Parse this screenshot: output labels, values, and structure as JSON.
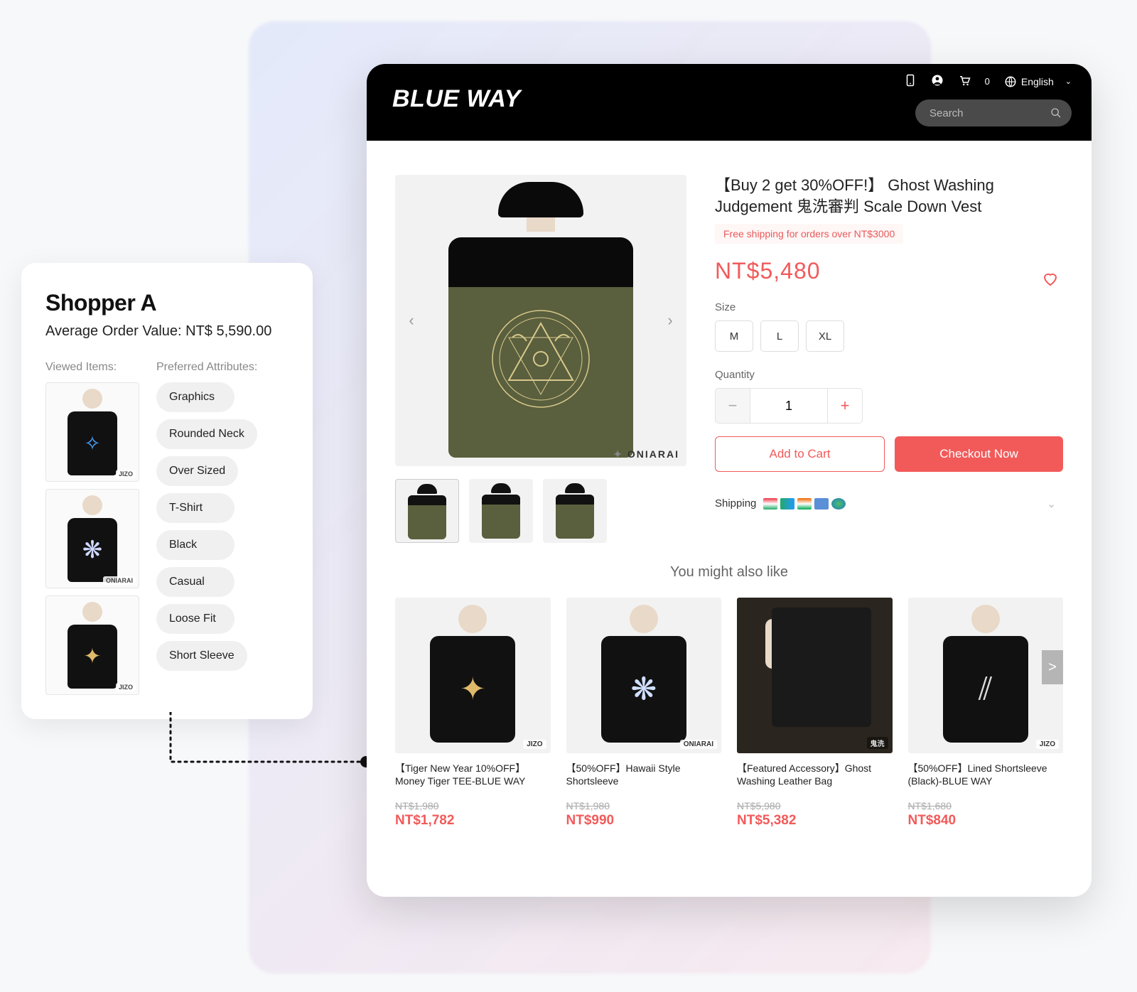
{
  "shopper_card": {
    "title": "Shopper A",
    "aov_label": "Average Order Value: NT$ 5,590.00",
    "viewed_head": "Viewed Items:",
    "pref_head": "Preferred Attributes:",
    "viewed_brands": [
      "JIZO",
      "ONIARAI",
      "JIZO"
    ],
    "attributes": [
      "Graphics",
      "Rounded Neck",
      "Over Sized",
      "T-Shirt",
      "Black",
      "Casual",
      "Loose Fit",
      "Short Sleeve"
    ]
  },
  "header": {
    "logo": "BLUE WAY",
    "cart_count": "0",
    "language": "English",
    "search_placeholder": "Search"
  },
  "product": {
    "title": "【Buy 2 get 30%OFF!】 Ghost Washing Judgement 鬼洗審判 Scale Down Vest",
    "shipping_badge": "Free shipping for orders over NT$3000",
    "price": "NT$5,480",
    "size_label": "Size",
    "sizes": [
      "M",
      "L",
      "XL"
    ],
    "qty_label": "Quantity",
    "qty_value": "1",
    "add_to_cart": "Add to Cart",
    "checkout_now": "Checkout Now",
    "shipping_label": "Shipping",
    "gallery_brand": "ONIARAI"
  },
  "recs": {
    "title": "You might also like",
    "items": [
      {
        "name": "【Tiger New Year 10%OFF】Money Tiger TEE-BLUE WAY",
        "old": "NT$1,980",
        "price": "NT$1,782",
        "brand": "JIZO",
        "graphic_color": "#e0b96a"
      },
      {
        "name": "【50%OFF】Hawaii Style Shortsleeve",
        "old": "NT$1,980",
        "price": "NT$990",
        "brand": "ONIARAI",
        "graphic_color": "#cfe0ff"
      },
      {
        "name": "【Featured Accessory】Ghost Washing Leather Bag",
        "old": "NT$5,980",
        "price": "NT$5,382",
        "brand": "鬼洗",
        "is_bag": true
      },
      {
        "name": "【50%OFF】Lined Shortsleeve (Black)-BLUE WAY",
        "old": "NT$1,680",
        "price": "NT$840",
        "brand": "JIZO",
        "graphic_color": "#ddd"
      }
    ]
  }
}
